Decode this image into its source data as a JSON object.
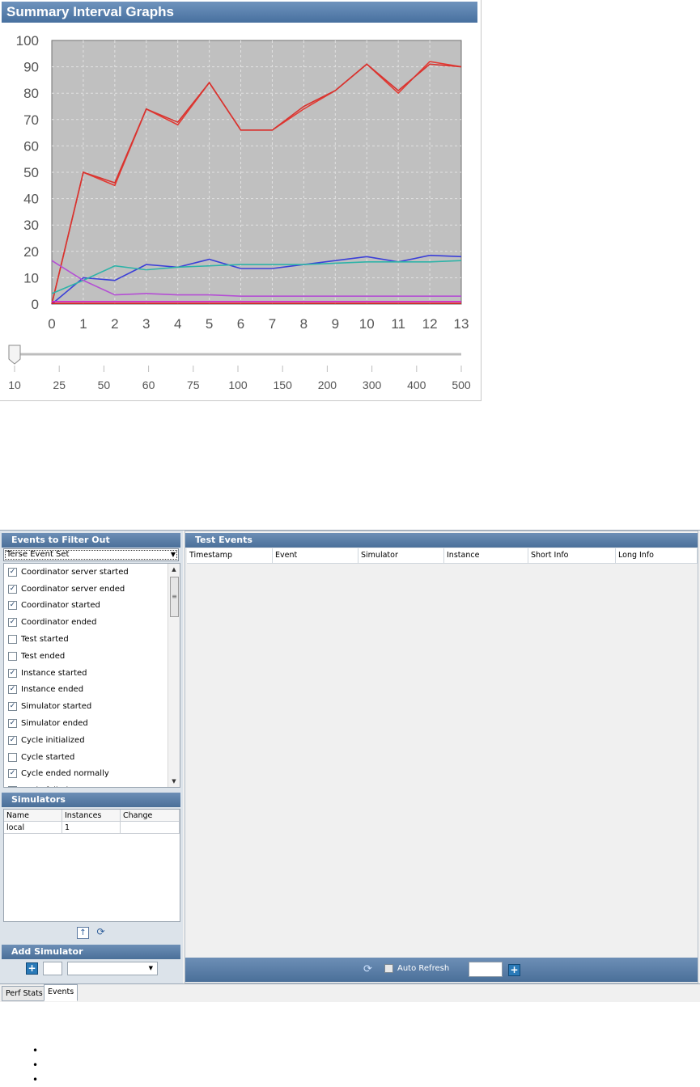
{
  "graph": {
    "title": "Summary Interval Graphs",
    "slider_value": 10,
    "slider_ticks": [
      "10",
      "25",
      "50",
      "60",
      "75",
      "100",
      "150",
      "200",
      "300",
      "400",
      "500"
    ]
  },
  "chart_data": {
    "type": "line",
    "title": "",
    "xlabel": "",
    "ylabel": "",
    "xlim": [
      0,
      13
    ],
    "ylim": [
      0,
      100
    ],
    "x_ticks": [
      "0",
      "1",
      "2",
      "3",
      "4",
      "5",
      "6",
      "7",
      "8",
      "9",
      "10",
      "11",
      "12",
      "13"
    ],
    "y_ticks": [
      "0",
      "10",
      "20",
      "30",
      "40",
      "50",
      "60",
      "70",
      "80",
      "90",
      "100"
    ],
    "grid": true,
    "x": [
      0,
      1,
      2,
      3,
      4,
      5,
      6,
      7,
      8,
      9,
      10,
      11,
      12,
      13
    ],
    "series": [
      {
        "color": "#e23a33",
        "values": [
          0,
          50,
          45,
          74,
          68,
          84,
          66,
          66,
          74,
          81,
          91,
          80,
          92,
          90
        ]
      },
      {
        "color": "#d8332f",
        "values": [
          0,
          50,
          46,
          74,
          69,
          84,
          66,
          66,
          75,
          81,
          91,
          81,
          91,
          90
        ]
      },
      {
        "color": "#3b3fd8",
        "values": [
          0,
          10,
          9,
          15,
          14,
          17,
          13.5,
          13.5,
          15,
          16.5,
          18,
          16,
          18.5,
          18
        ]
      },
      {
        "color": "#2fb3a8",
        "values": [
          4,
          9,
          14.5,
          13,
          14,
          14.5,
          15,
          15,
          15,
          15.5,
          16,
          16,
          16,
          16.5
        ]
      },
      {
        "color": "#b44fd4",
        "values": [
          16.5,
          9,
          3.5,
          4,
          3.5,
          3.5,
          3,
          3,
          3,
          3,
          3,
          3,
          3,
          3
        ]
      },
      {
        "color": "#d51fc4",
        "values": [
          1,
          1,
          1,
          1,
          1,
          1,
          1,
          1,
          1,
          1,
          1,
          1,
          1,
          1
        ]
      },
      {
        "color": "#e01e1e",
        "values": [
          0.3,
          0.3,
          0.3,
          0.3,
          0.3,
          0.3,
          0.3,
          0.3,
          0.3,
          0.3,
          0.3,
          0.3,
          0.3,
          0.3
        ]
      }
    ]
  },
  "events_app": {
    "filter_title": "Events to Filter Out",
    "event_set": "Terse Event Set",
    "filters": [
      {
        "label": "Coordinator server started",
        "checked": true
      },
      {
        "label": "Coordinator server ended",
        "checked": true
      },
      {
        "label": "Coordinator started",
        "checked": true
      },
      {
        "label": "Coordinator ended",
        "checked": true
      },
      {
        "label": "Test started",
        "checked": false
      },
      {
        "label": "Test ended",
        "checked": false
      },
      {
        "label": "Instance started",
        "checked": true
      },
      {
        "label": "Instance ended",
        "checked": true
      },
      {
        "label": "Simulator started",
        "checked": true
      },
      {
        "label": "Simulator ended",
        "checked": true
      },
      {
        "label": "Cycle initialized",
        "checked": true
      },
      {
        "label": "Cycle started",
        "checked": false
      },
      {
        "label": "Cycle ended normally",
        "checked": true
      },
      {
        "label": "Cycle failed",
        "checked": false
      }
    ],
    "simulators_title": "Simulators",
    "sim_columns": [
      "Name",
      "Instances",
      "Change"
    ],
    "sim_rows": [
      [
        "local",
        "1",
        ""
      ]
    ],
    "add_simulator_title": "Add Simulator",
    "test_events_title": "Test Events",
    "event_columns": [
      "Timestamp",
      "Event",
      "Simulator",
      "Instance",
      "Short Info",
      "Long Info"
    ],
    "auto_refresh_label": "Auto Refresh",
    "auto_refresh_checked": false,
    "tabs": [
      "Perf Stats",
      "Events"
    ],
    "active_tab": "Events"
  },
  "bullets": [
    "",
    "",
    ""
  ]
}
